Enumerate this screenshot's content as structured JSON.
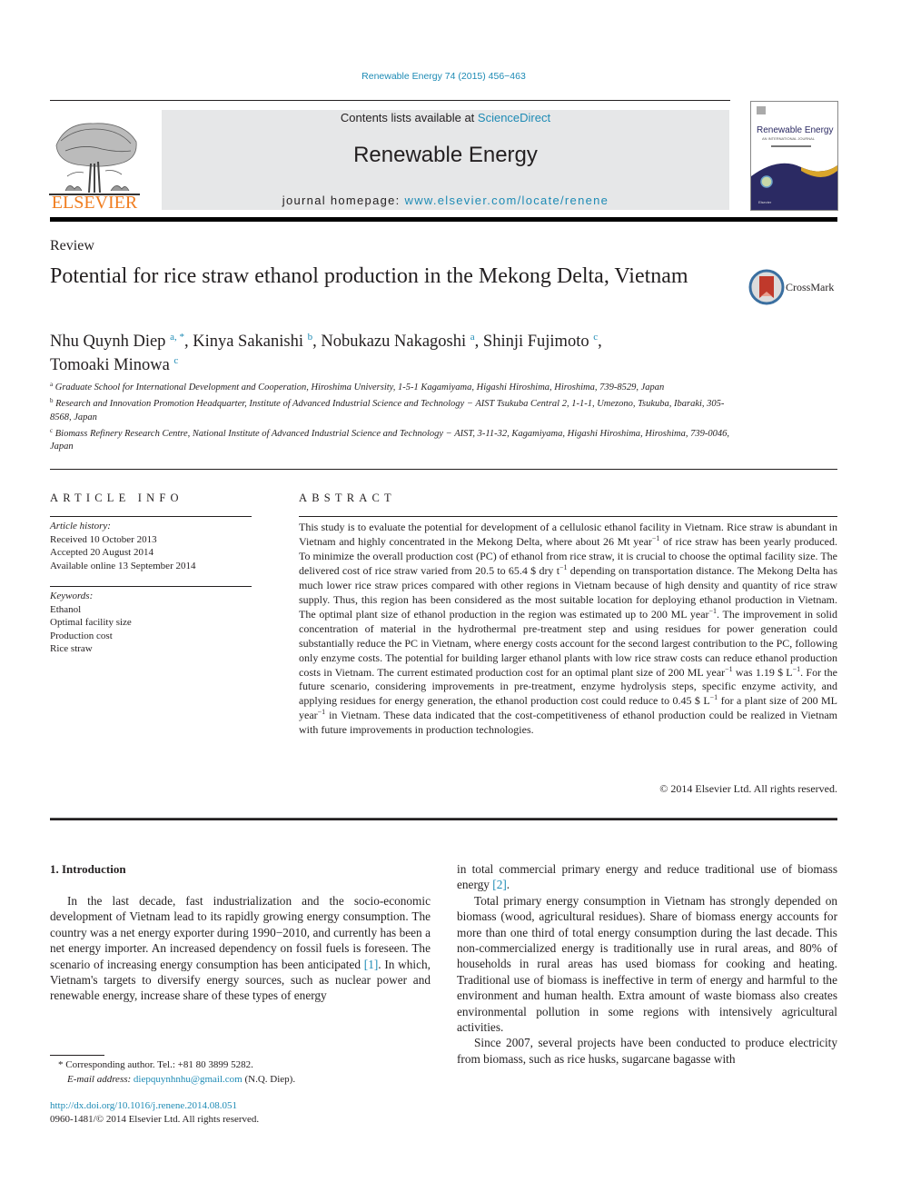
{
  "header": {
    "citation": "Renewable Energy 74 (2015) 456−463",
    "contents_prefix": "Contents lists available at ",
    "contents_link": "ScienceDirect",
    "journal_name": "Renewable Energy",
    "homepage_prefix": "journal homepage: ",
    "homepage_link": "www.elsevier.com/locate/renene",
    "publisher_logo": "ELSEVIER",
    "cover_title": "Renewable Energy",
    "cover_subtitle": "AN INTERNATIONAL JOURNAL",
    "crossmark_label": "CrossMark"
  },
  "colors": {
    "link": "#1e8bb5",
    "elsevier_orange": "#f07d1f",
    "masthead_gray": "#e6e7e8",
    "cover_navy": "#2b2a63",
    "cover_gold": "#d9a52b"
  },
  "article": {
    "type": "Review",
    "title": "Potential for rice straw ethanol production in the Mekong Delta, Vietnam",
    "authors": [
      {
        "name": "Nhu Quynh Diep",
        "sup": "a, *",
        "sep": ", "
      },
      {
        "name": "Kinya Sakanishi",
        "sup": "b",
        "sep": ", "
      },
      {
        "name": "Nobukazu Nakagoshi",
        "sup": "a",
        "sep": ", "
      },
      {
        "name": "Shinji Fujimoto",
        "sup": "c",
        "sep": ","
      },
      {
        "name": "Tomoaki Minowa",
        "sup": "c",
        "sep": ""
      }
    ],
    "affiliations": [
      {
        "sup": "a",
        "text": "Graduate School for International Development and Cooperation, Hiroshima University, 1-5-1 Kagamiyama, Higashi Hiroshima, Hiroshima, 739-8529, Japan"
      },
      {
        "sup": "b",
        "text": "Research and Innovation Promotion Headquarter, Institute of Advanced Industrial Science and Technology − AIST Tsukuba Central 2, 1-1-1, Umezono, Tsukuba, Ibaraki, 305-8568, Japan"
      },
      {
        "sup": "c",
        "text": "Biomass Refinery Research Centre, National Institute of Advanced Industrial Science and Technology − AIST, 3-11-32, Kagamiyama, Higashi Hiroshima, Hiroshima, 739-0046, Japan"
      }
    ]
  },
  "article_info": {
    "heading": "ARTICLE INFO",
    "history_label": "Article history:",
    "history": [
      "Received 10 October 2013",
      "Accepted 20 August 2014",
      "Available online 13 September 2014"
    ],
    "keywords_label": "Keywords:",
    "keywords": [
      "Ethanol",
      "Optimal facility size",
      "Production cost",
      "Rice straw"
    ]
  },
  "abstract": {
    "heading": "ABSTRACT",
    "segments": [
      {
        "t": "This study is to evaluate the potential for development of a cellulosic ethanol facility in Vietnam. Rice straw is abundant in Vietnam and highly concentrated in the Mekong Delta, where about 26 Mt year"
      },
      {
        "sup": "−1"
      },
      {
        "t": " of rice straw has been yearly produced. To minimize the overall production cost (PC) of ethanol from rice straw, it is crucial to choose the optimal facility size. The delivered cost of rice straw varied from 20.5 to 65.4 $ dry t"
      },
      {
        "sup": "−1"
      },
      {
        "t": " depending on transportation distance. The Mekong Delta has much lower rice straw prices compared with other regions in Vietnam because of high density and quantity of rice straw supply. Thus, this region has been considered as the most suitable location for deploying ethanol production in Vietnam. The optimal plant size of ethanol production in the region was estimated up to 200 ML year"
      },
      {
        "sup": "−1"
      },
      {
        "t": ". The improvement in solid concentration of material in the hydrothermal pre-treatment step and using residues for power generation could substantially reduce the PC in Vietnam, where energy costs account for the second largest contribution to the PC, following only enzyme costs. The potential for building larger ethanol plants with low rice straw costs can reduce ethanol production costs in Vietnam. The current estimated production cost for an optimal plant size of 200 ML year"
      },
      {
        "sup": "−1"
      },
      {
        "t": " was 1.19 $ L"
      },
      {
        "sup": "−1"
      },
      {
        "t": ". For the future scenario, considering improvements in pre-treatment, enzyme hydrolysis steps, specific enzyme activity, and applying residues for energy generation, the ethanol production cost could reduce to 0.45 $ L"
      },
      {
        "sup": "−1"
      },
      {
        "t": " for a plant size of 200 ML year"
      },
      {
        "sup": "−1"
      },
      {
        "t": " in Vietnam. These data indicated that the cost-competitiveness of ethanol production could be realized in Vietnam with future improvements in production technologies."
      }
    ],
    "copyright": "© 2014 Elsevier Ltd. All rights reserved."
  },
  "body": {
    "section_title": "1.  Introduction",
    "left_paragraph": {
      "before_ref": "In the last decade, fast industrialization and the socio-economic development of Vietnam lead to its rapidly growing energy consumption. The country was a net energy exporter during 1990−2010, and currently has been a net energy importer. An increased dependency on fossil fuels is foreseen. The scenario of increasing energy consumption has been anticipated ",
      "ref": "[1]",
      "after_ref": ". In which, Vietnam's targets to diversify energy sources, such as nuclear power and renewable energy, increase share of these types of energy"
    },
    "right_continuation": {
      "before_ref": "in total commercial primary energy and reduce traditional use of biomass energy ",
      "ref": "[2]",
      "after_ref": "."
    },
    "right_paragraphs": [
      "Total primary energy consumption in Vietnam has strongly depended on biomass (wood, agricultural residues). Share of biomass energy accounts for more than one third of total energy consumption during the last decade. This non-commercialized energy is traditionally use in rural areas, and 80% of households in rural areas has used biomass for cooking and heating. Traditional use of biomass is ineffective in term of energy and harmful to the environment and human health. Extra amount of waste biomass also creates environmental pollution in some regions with intensively agricultural activities.",
      "Since 2007, several projects have been conducted to produce electricity from biomass, such as rice husks, sugarcane bagasse with"
    ]
  },
  "footnotes": {
    "corresponding": "* Corresponding author. Tel.: +81 80 3899 5282.",
    "email_label": "E-mail address: ",
    "email": "diepquynhnhu@gmail.com",
    "email_suffix": " (N.Q. Diep).",
    "doi": "http://dx.doi.org/10.1016/j.renene.2014.08.051",
    "issn": "0960-1481/© 2014 Elsevier Ltd. All rights reserved."
  }
}
